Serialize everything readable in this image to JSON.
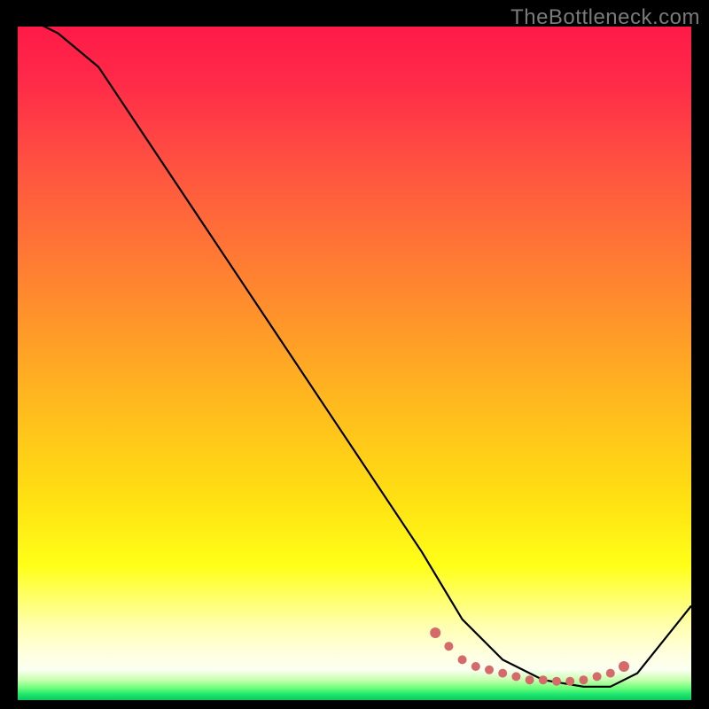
{
  "watermark": "TheBottleneck.com",
  "chart_data": {
    "type": "line",
    "title": "",
    "xlabel": "",
    "ylabel": "",
    "xlim": [
      0,
      100
    ],
    "ylim": [
      0,
      100
    ],
    "grid": false,
    "legend": false,
    "curve": {
      "name": "bottleneck-curve",
      "x": [
        0,
        6,
        12,
        60,
        66,
        72,
        78,
        84,
        88,
        92,
        100
      ],
      "values": [
        102,
        99,
        94,
        22,
        12,
        6,
        3,
        2,
        2,
        4,
        14
      ]
    },
    "markers": {
      "name": "optimal-range",
      "x": [
        62,
        64,
        66,
        68,
        70,
        72,
        74,
        76,
        78,
        80,
        82,
        84,
        86,
        88,
        90
      ],
      "values": [
        10,
        8,
        6,
        5,
        4.5,
        4,
        3.5,
        3,
        3,
        2.8,
        2.8,
        3,
        3.5,
        4,
        5
      ]
    },
    "colors": {
      "curve": "#000000",
      "marker": "#d46a6a",
      "gradient_top": "#ff1a47",
      "gradient_mid": "#ffe012",
      "gradient_bottom": "#0cc95e"
    }
  }
}
